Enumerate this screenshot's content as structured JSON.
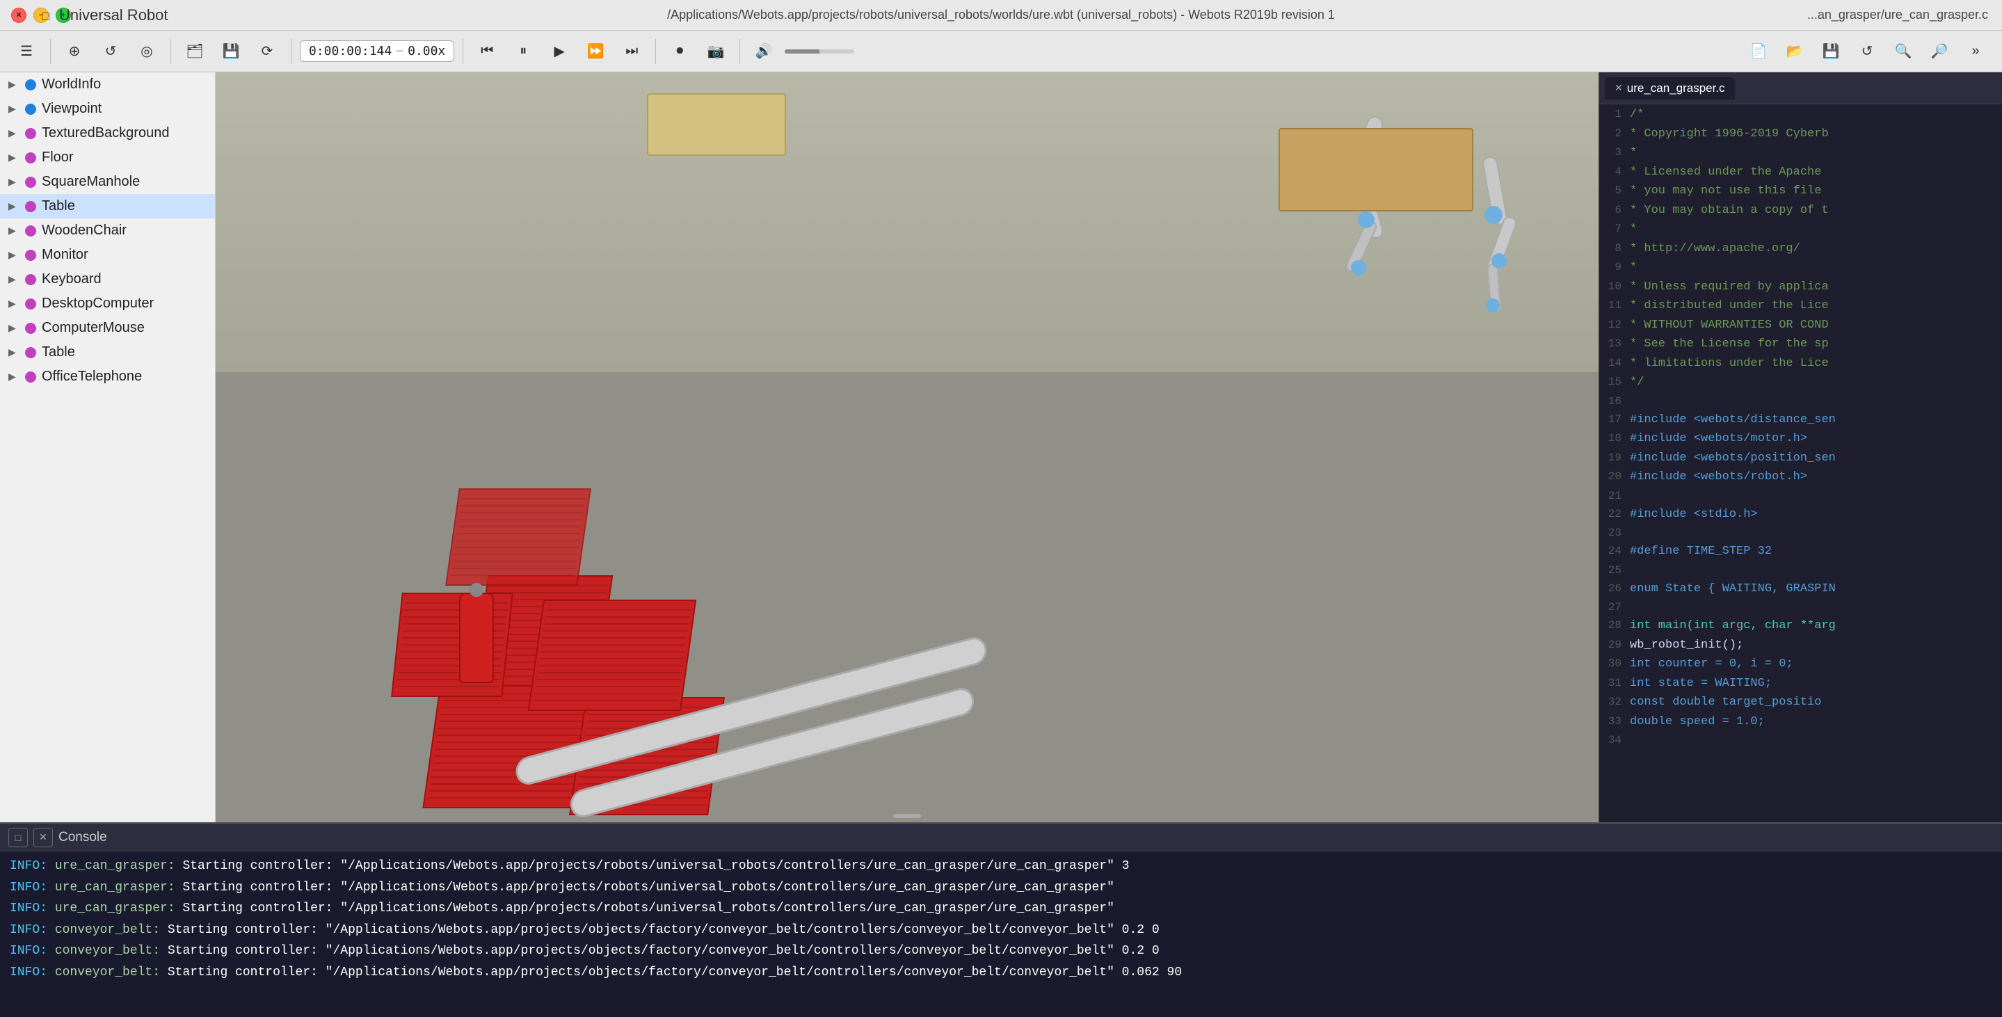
{
  "titlebar": {
    "title": "/Applications/Webots.app/projects/robots/universal_robots/worlds/ure.wbt (universal_robots) - Webots R2019b revision 1",
    "app_name": "Universal Robot",
    "right_title": "...an_grasper/ure_can_grasper.c"
  },
  "toolbar": {
    "time": "0:00:00:144",
    "speed": "0.00x"
  },
  "sidebar": {
    "items": [
      {
        "id": "worldinfo",
        "label": "WorldInfo",
        "dot": "blue",
        "expanded": false
      },
      {
        "id": "viewpoint",
        "label": "Viewpoint",
        "dot": "blue",
        "expanded": false
      },
      {
        "id": "texturedbg",
        "label": "TexturedBackground",
        "dot": "purple",
        "expanded": false
      },
      {
        "id": "floor",
        "label": "Floor",
        "dot": "purple",
        "expanded": false
      },
      {
        "id": "squaremanhole",
        "label": "SquareManhole",
        "dot": "purple",
        "expanded": false
      },
      {
        "id": "table1",
        "label": "Table",
        "dot": "purple",
        "expanded": false,
        "highlight": true
      },
      {
        "id": "woodenchair",
        "label": "WoodenChair",
        "dot": "purple",
        "expanded": false
      },
      {
        "id": "monitor",
        "label": "Monitor",
        "dot": "purple",
        "expanded": false
      },
      {
        "id": "keyboard",
        "label": "Keyboard",
        "dot": "purple",
        "expanded": false
      },
      {
        "id": "desktopcomputer",
        "label": "DesktopComputer",
        "dot": "purple",
        "expanded": false
      },
      {
        "id": "computermouse",
        "label": "ComputerMouse",
        "dot": "purple",
        "expanded": false
      },
      {
        "id": "table2",
        "label": "Table",
        "dot": "purple",
        "expanded": false
      },
      {
        "id": "officetelephone",
        "label": "OfficeTelephone",
        "dot": "purple",
        "expanded": false
      }
    ]
  },
  "code_editor": {
    "tab_label": "ure_can_grasper.c",
    "lines": [
      {
        "num": 1,
        "code": "/*",
        "class": "c-comment"
      },
      {
        "num": 2,
        "code": " * Copyright 1996-2019 Cyberb",
        "class": "c-comment"
      },
      {
        "num": 3,
        "code": " *",
        "class": "c-comment"
      },
      {
        "num": 4,
        "code": " * Licensed under the Apache",
        "class": "c-comment"
      },
      {
        "num": 5,
        "code": " * you may not use this file",
        "class": "c-comment"
      },
      {
        "num": 6,
        "code": " * You may obtain a copy of t",
        "class": "c-comment"
      },
      {
        "num": 7,
        "code": " *",
        "class": "c-comment"
      },
      {
        "num": 8,
        "code": " *     http://www.apache.org/",
        "class": "c-comment"
      },
      {
        "num": 9,
        "code": " *",
        "class": "c-comment"
      },
      {
        "num": 10,
        "code": " * Unless required by applica",
        "class": "c-comment"
      },
      {
        "num": 11,
        "code": " * distributed under the Lice",
        "class": "c-comment"
      },
      {
        "num": 12,
        "code": " * WITHOUT WARRANTIES OR COND",
        "class": "c-comment"
      },
      {
        "num": 13,
        "code": " * See the License for the sp",
        "class": "c-comment"
      },
      {
        "num": 14,
        "code": " * limitations under the Lice",
        "class": "c-comment"
      },
      {
        "num": 15,
        "code": " */",
        "class": "c-comment"
      },
      {
        "num": 16,
        "code": "",
        "class": ""
      },
      {
        "num": 17,
        "code": "#include <webots/distance_sen",
        "class": "c-preprocessor"
      },
      {
        "num": 18,
        "code": "#include <webots/motor.h>",
        "class": "c-preprocessor"
      },
      {
        "num": 19,
        "code": "#include <webots/position_sen",
        "class": "c-preprocessor"
      },
      {
        "num": 20,
        "code": "#include <webots/robot.h>",
        "class": "c-preprocessor"
      },
      {
        "num": 21,
        "code": "",
        "class": ""
      },
      {
        "num": 22,
        "code": "#include <stdio.h>",
        "class": "c-preprocessor"
      },
      {
        "num": 23,
        "code": "",
        "class": ""
      },
      {
        "num": 24,
        "code": "#define TIME_STEP 32",
        "class": "c-preprocessor"
      },
      {
        "num": 25,
        "code": "",
        "class": ""
      },
      {
        "num": 26,
        "code": "enum State { WAITING, GRASPIN",
        "class": "c-keyword"
      },
      {
        "num": 27,
        "code": "",
        "class": ""
      },
      {
        "num": 28,
        "code": "int main(int argc, char **arg",
        "class": "c-type"
      },
      {
        "num": 29,
        "code": "  wb_robot_init();",
        "class": ""
      },
      {
        "num": 30,
        "code": "  int counter = 0, i = 0;",
        "class": "c-keyword"
      },
      {
        "num": 31,
        "code": "  int state = WAITING;",
        "class": "c-keyword"
      },
      {
        "num": 32,
        "code": "  const double target_positio",
        "class": "c-keyword"
      },
      {
        "num": 33,
        "code": "  double speed = 1.0;",
        "class": "c-keyword"
      },
      {
        "num": 34,
        "code": "",
        "class": ""
      }
    ]
  },
  "console": {
    "title": "Console",
    "lines": [
      "INFO: ure_can_grasper: Starting controller: \"/Applications/Webots.app/projects/robots/universal_robots/controllers/ure_can_grasper/ure_can_grasper\" 3",
      "INFO: ure_can_grasper: Starting controller: \"/Applications/Webots.app/projects/robots/universal_robots/controllers/ure_can_grasper/ure_can_grasper\"",
      "INFO: ure_can_grasper: Starting controller: \"/Applications/Webots.app/projects/robots/universal_robots/controllers/ure_can_grasper/ure_can_grasper\"",
      "INFO: conveyor_belt: Starting controller: \"/Applications/Webots.app/projects/objects/factory/conveyor_belt/controllers/conveyor_belt/conveyor_belt\" 0.2 0",
      "INFO: conveyor_belt: Starting controller: \"/Applications/Webots.app/projects/objects/factory/conveyor_belt/controllers/conveyor_belt/conveyor_belt\" 0.2 0",
      "INFO: conveyor_belt: Starting controller: \"/Applications/Webots.app/projects/objects/factory/conveyor_belt/controllers/conveyor_belt/conveyor_belt\" 0.062 90"
    ]
  },
  "icons": {
    "arrow_right": "▶",
    "arrow_down": "▼",
    "sidebar_toggle": "☰",
    "add": "+",
    "reload": "↺",
    "eye": "👁",
    "folder": "📁",
    "save": "💾",
    "reset": "⟳",
    "step_back": "⏮",
    "pause": "⏸",
    "play": "▶",
    "fast": "⏩",
    "faster": "⏭",
    "record": "⏺",
    "screenshot": "📷",
    "volume": "🔊",
    "new_file": "📄",
    "open": "📂",
    "save_file": "💾",
    "search": "🔍",
    "zoom_in": "🔎",
    "more": "»"
  }
}
